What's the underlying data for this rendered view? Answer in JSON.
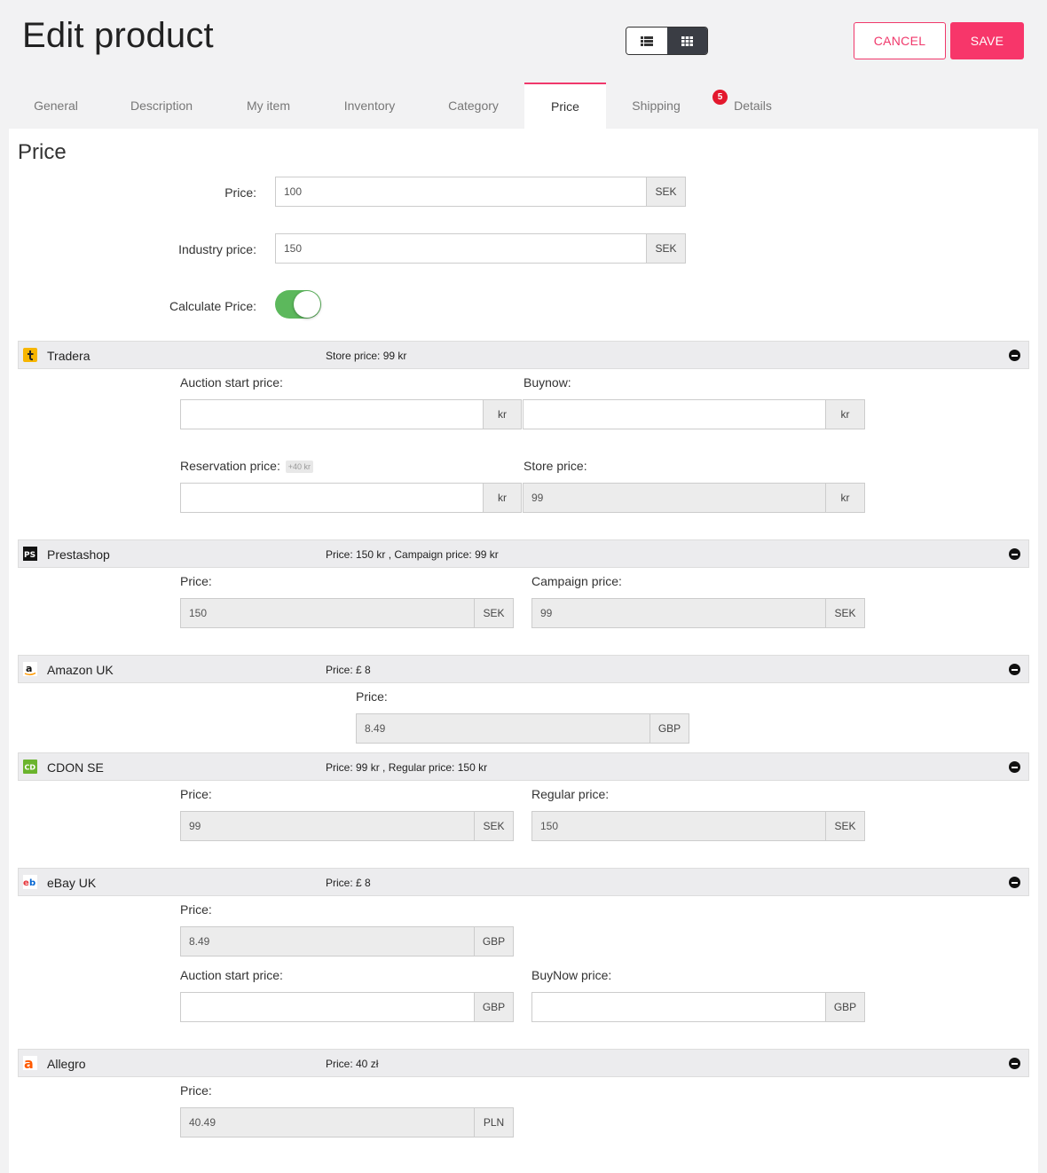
{
  "header": {
    "title": "Edit product",
    "cancel_label": "CANCEL",
    "save_label": "SAVE",
    "view_toggle": [
      {
        "icon": "list-icon",
        "active": false
      },
      {
        "icon": "grid-icon",
        "active": true
      }
    ]
  },
  "tabs": [
    {
      "label": "General"
    },
    {
      "label": "Description"
    },
    {
      "label": "My item"
    },
    {
      "label": "Inventory"
    },
    {
      "label": "Category"
    },
    {
      "label": "Price",
      "active": true
    },
    {
      "label": "Shipping"
    },
    {
      "label": "Details",
      "badge": "5"
    }
  ],
  "section": {
    "title": "Price"
  },
  "main_fields": {
    "price_label": "Price:",
    "price_value": "100",
    "price_currency": "SEK",
    "industry_label": "Industry price:",
    "industry_value": "150",
    "industry_currency": "SEK",
    "calculate_label": "Calculate Price:",
    "calculate_on": true
  },
  "marketplaces": {
    "tradera": {
      "name": "Tradera",
      "summary": "Store price: 99 kr",
      "auction_label": "Auction start price:",
      "auction_value": "",
      "auction_unit": "kr",
      "buynow_label": "Buynow:",
      "buynow_value": "",
      "buynow_unit": "kr",
      "reservation_label": "Reservation price:",
      "reservation_hint": "+40 kr",
      "reservation_value": "",
      "reservation_unit": "kr",
      "store_label": "Store price:",
      "store_value": "99",
      "store_unit": "kr"
    },
    "prestashop": {
      "name": "Prestashop",
      "summary": "Price: 150 kr , Campaign price: 99 kr",
      "price_label": "Price:",
      "price_value": "150",
      "price_unit": "SEK",
      "campaign_label": "Campaign price:",
      "campaign_value": "99",
      "campaign_unit": "SEK"
    },
    "amazon": {
      "name": "Amazon UK",
      "summary": "Price: £ 8",
      "price_label": "Price:",
      "price_value": "8.49",
      "price_unit": "GBP"
    },
    "cdon": {
      "name": "CDON SE",
      "summary": "Price: 99 kr , Regular price: 150 kr",
      "price_label": "Price:",
      "price_value": "99",
      "price_unit": "SEK",
      "regular_label": "Regular price:",
      "regular_value": "150",
      "regular_unit": "SEK"
    },
    "ebay": {
      "name": "eBay UK",
      "summary": "Price: £ 8",
      "price_label": "Price:",
      "price_value": "8.49",
      "price_unit": "GBP",
      "auction_label": "Auction start price:",
      "auction_value": "",
      "auction_unit": "GBP",
      "buynow_label": "BuyNow price:",
      "buynow_value": "",
      "buynow_unit": "GBP"
    },
    "allegro": {
      "name": "Allegro",
      "summary": "Price: 40 zł",
      "price_label": "Price:",
      "price_value": "40.49",
      "price_unit": "PLN"
    }
  },
  "colors": {
    "accent": "#f7366a",
    "toggle_on": "#5cb85c",
    "badge": "#e3182d"
  }
}
